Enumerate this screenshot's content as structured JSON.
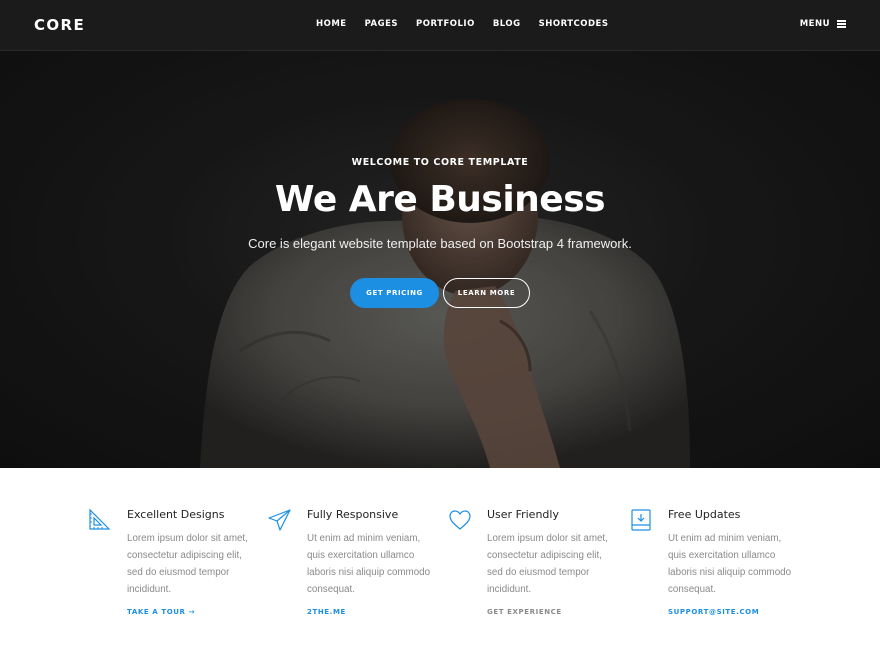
{
  "nav": {
    "brand": "CORE",
    "links": [
      "HOME",
      "PAGES",
      "PORTFOLIO",
      "BLOG",
      "SHORTCODES"
    ],
    "menu_label": "MENU"
  },
  "hero": {
    "eyebrow": "WELCOME TO CORE TEMPLATE",
    "title": "We Are Business",
    "subtitle": "Core is elegant website template based on Bootstrap 4 framework.",
    "primary_button": "GET PRICING",
    "secondary_button": "LEARN MORE"
  },
  "features": [
    {
      "icon": "ruler-triangle-icon",
      "title": "Excellent Designs",
      "lines": [
        "Lorem ipsum dolor sit amet,",
        "consectetur adipiscing elit,",
        "sed do eiusmod tempor",
        "incididunt."
      ],
      "link": "TAKE A TOUR →",
      "link_color": "#1c8fe3"
    },
    {
      "icon": "paper-plane-icon",
      "title": "Fully Responsive",
      "lines": [
        "Ut enim ad minim veniam,",
        "quis exercitation ullamco",
        "laboris nisi aliquip commodo",
        "consequat."
      ],
      "link": "2THE.ME",
      "link_color": "#1c8fe3"
    },
    {
      "icon": "heart-icon",
      "title": "User Friendly",
      "lines": [
        "Lorem ipsum dolor sit amet,",
        "consectetur adipiscing elit,",
        "sed do eiusmod tempor",
        "incididunt."
      ],
      "link": "GET EXPERIENCE",
      "link_color": "#8a8a8a"
    },
    {
      "icon": "download-drive-icon",
      "title": "Free Updates",
      "lines": [
        "Ut enim ad minim veniam,",
        "quis exercitation ullamco",
        "laboris nisi aliquip commodo",
        "consequat."
      ],
      "link": "SUPPORT@SITE.COM",
      "link_color": "#1c8fe3"
    }
  ],
  "colors": {
    "accent": "#1c8fe3",
    "navbar_bg": "#1b1b1b",
    "body_text": "#8a8a8a",
    "heading_text": "#222222"
  }
}
